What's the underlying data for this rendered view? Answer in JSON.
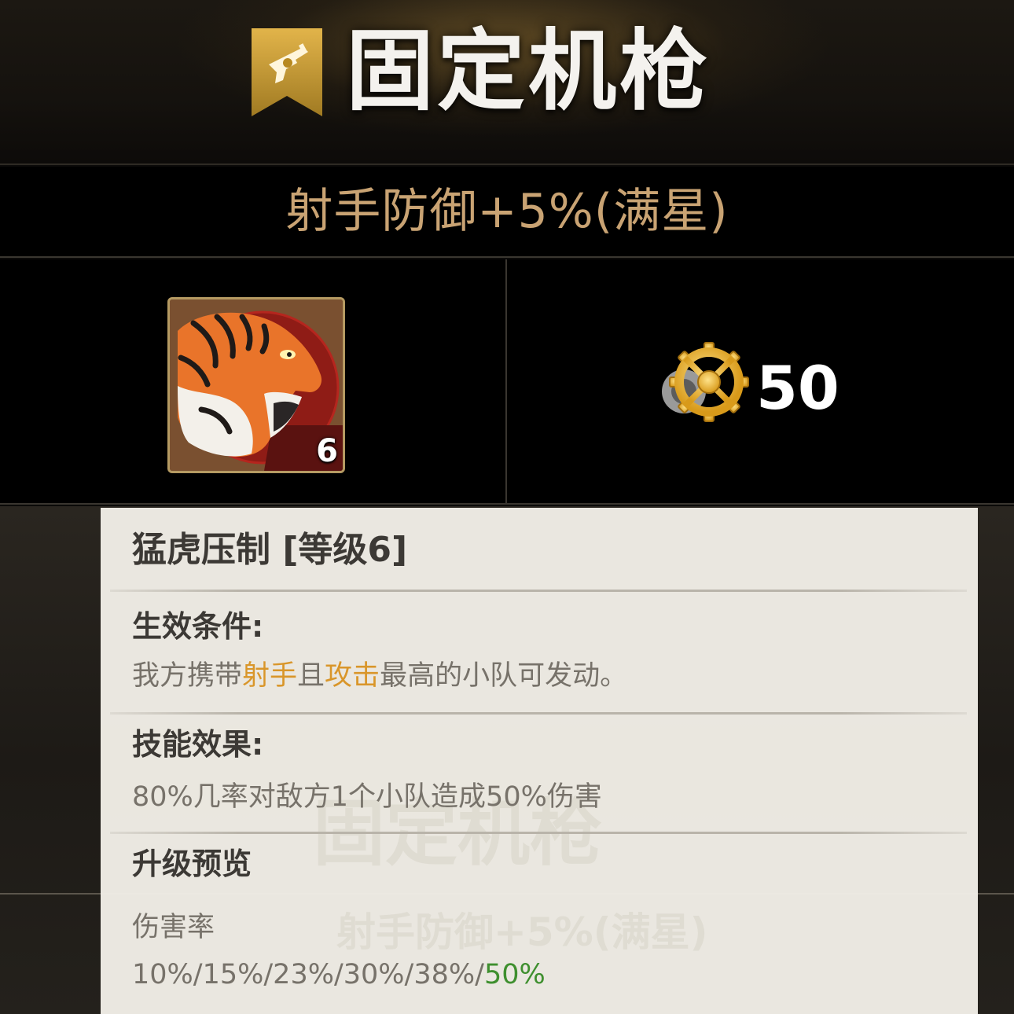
{
  "header": {
    "weapon_icon": "pistol-bookmark-icon",
    "title": "固定机枪"
  },
  "bonus": {
    "text": "射手防御+5%(满星)"
  },
  "skill": {
    "icon": "tiger-head-icon",
    "level": "6"
  },
  "cost": {
    "icon": "gear-icon",
    "amount": "50"
  },
  "tooltip": {
    "title": "猛虎压制 [等级6]",
    "condition": {
      "heading": "生效条件:",
      "segments": [
        "我方携带",
        "射手",
        "且",
        "攻击",
        "最高的小队可发动。"
      ]
    },
    "effect": {
      "heading": "技能效果:",
      "text": "80%几率对敌方1个小队造成50%伤害"
    },
    "upgrade": {
      "heading": "升级预览",
      "stat_label": "伤害率",
      "values_prefix": "10%/15%/23%/30%/38%/",
      "values_current": "50%"
    }
  },
  "colors": {
    "accent_gold": "#c9a373",
    "highlight_orange": "#d9962a",
    "highlight_green": "#3e8f2e",
    "panel_bg": "#f2efe8"
  }
}
